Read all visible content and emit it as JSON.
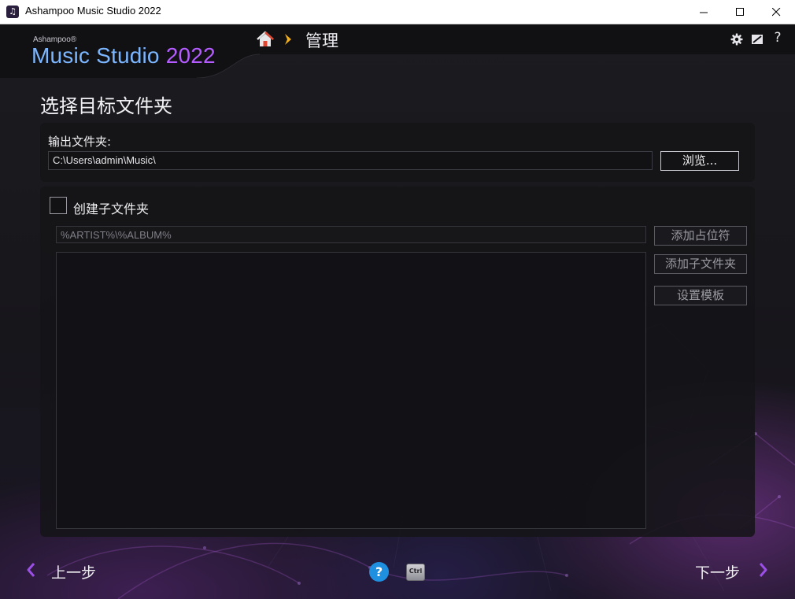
{
  "window": {
    "title": "Ashampoo Music Studio 2022",
    "icon": "music-note-icon"
  },
  "brand": {
    "company": "Ashampoo®",
    "product": "Music Studio",
    "year": "2022",
    "product_color": "#7bb6ff",
    "year_color": "#b45cff"
  },
  "breadcrumb": {
    "home_icon": "home-icon",
    "current": "管理"
  },
  "header_icons": [
    "gear-icon",
    "note-edit-icon",
    "help-icon"
  ],
  "header_help_glyph": "?",
  "page": {
    "title": "选择目标文件夹"
  },
  "output": {
    "label": "输出文件夹:",
    "path": "C:\\Users\\admin\\Music\\",
    "browse_label": "浏览..."
  },
  "subfolder": {
    "checkbox_label": "创建子文件夹",
    "checked": false,
    "template_value": "%ARTIST%\\%ALBUM%",
    "add_placeholder_label": "添加占位符",
    "add_subfolder_label": "添加子文件夹",
    "set_template_label": "设置模板"
  },
  "footer": {
    "back_label": "上一步",
    "next_label": "下一步",
    "help_glyph": "?",
    "ctrl_label": "Ctrl"
  },
  "colors": {
    "accent": "#8b3fd6",
    "chevron": "#f2b01e",
    "help_blue": "#1f8fe0"
  }
}
